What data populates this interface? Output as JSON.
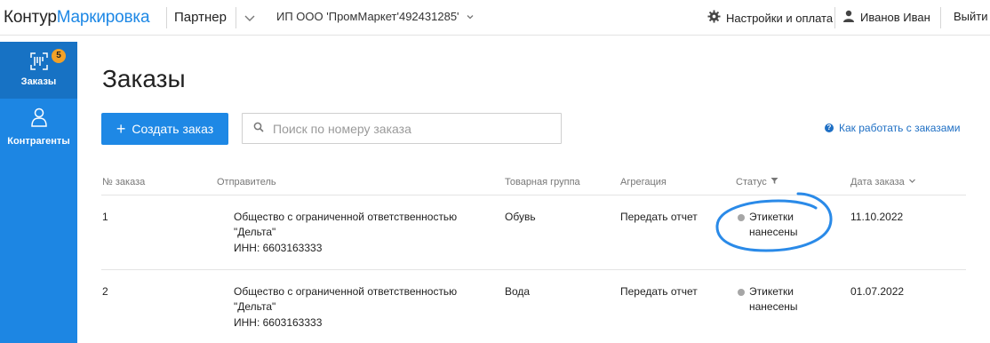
{
  "header": {
    "logo_kontur": "Контур",
    "logo_product": "Маркировка",
    "partner": "Партнер",
    "organization": "ИП ООО 'ПромМаркет'492431285'",
    "settings": "Настройки и оплата",
    "user": "Иванов Иван",
    "logout": "Выйти"
  },
  "sidebar": {
    "items": [
      {
        "label": "Заказы",
        "badge": "5",
        "icon": "barcode-icon"
      },
      {
        "label": "Контрагенты",
        "icon": "person-icon"
      }
    ]
  },
  "main": {
    "title": "Заказы",
    "create_button": "Создать заказ",
    "search_placeholder": "Поиск по номеру заказа",
    "help_link": "Как работать с заказами"
  },
  "table": {
    "columns": [
      "№ заказа",
      "Отправитель",
      "Товарная группа",
      "Агрегация",
      "Статус",
      "Дата заказа"
    ],
    "rows": [
      {
        "number": "1",
        "sender_line1": "Общество с ограниченной ответственностью",
        "sender_line2": "\"Дельта\"",
        "sender_inn": "ИНН: 6603163333",
        "group": "Обувь",
        "aggregation": "Передать отчет",
        "status_line1": "Этикетки",
        "status_line2": "нанесены",
        "date": "11.10.2022"
      },
      {
        "number": "2",
        "sender_line1": "Общество с ограниченной ответственностью",
        "sender_line2": "\"Дельта\"",
        "sender_inn": "ИНН: 6603163333",
        "group": "Вода",
        "aggregation": "Передать отчет",
        "status_line1": "Этикетки",
        "status_line2": "нанесены",
        "date": "01.07.2022"
      }
    ]
  },
  "colors": {
    "accent": "#1e88e5",
    "sidebar": "#1d86e3",
    "badge": "#f2a127",
    "status_dot": "#a6a6a6",
    "annotation": "#2a8ae8"
  }
}
